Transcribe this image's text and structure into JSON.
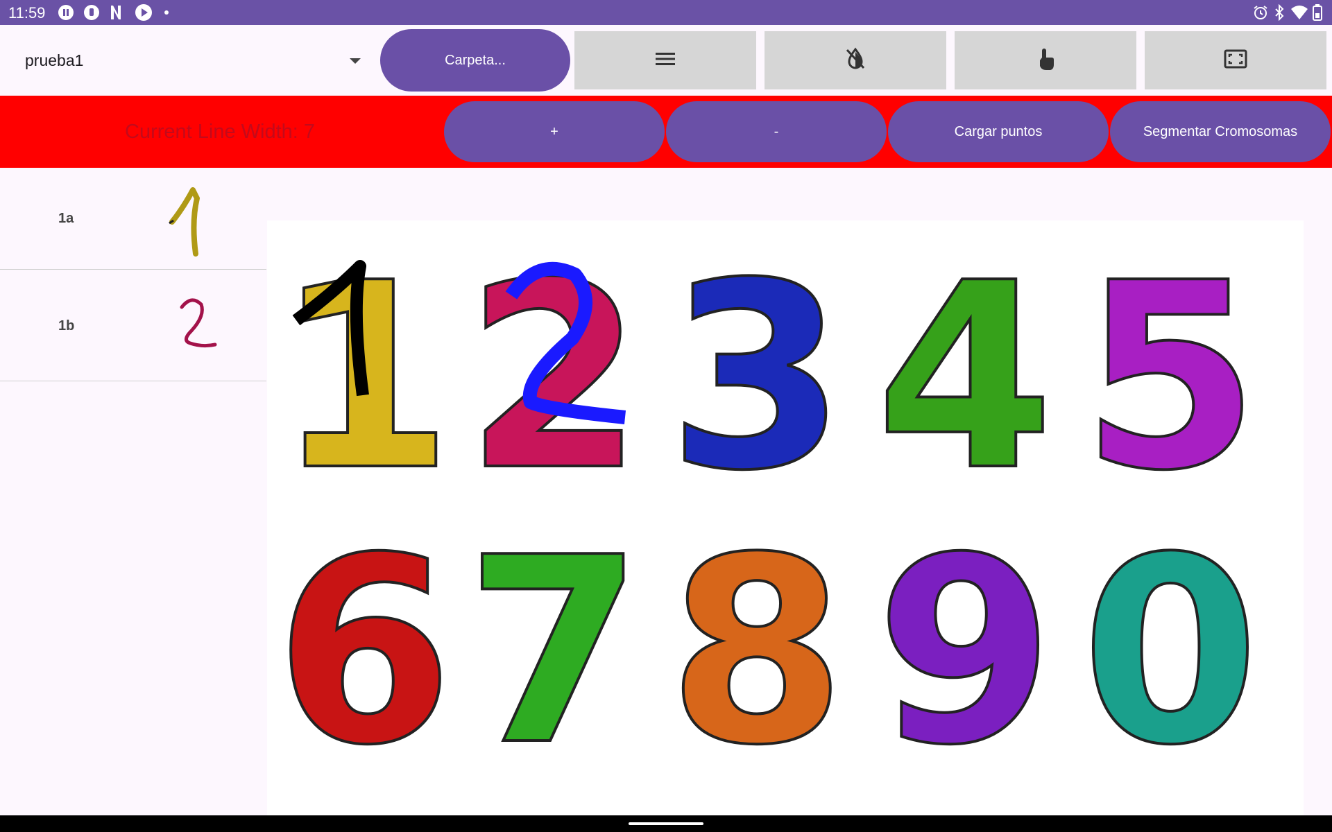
{
  "status_bar": {
    "time": "11:59",
    "left_icons": [
      "pause-circle-icon",
      "notification-icon",
      "n-logo-icon",
      "play-circle-icon",
      "dot-icon"
    ],
    "right_icons": [
      "alarm-icon",
      "bluetooth-icon",
      "wifi-icon",
      "battery-icon"
    ]
  },
  "toolbar": {
    "project_name": "prueba1",
    "folder_button": "Carpeta...",
    "tools": [
      "menu-icon",
      "invert-colors-off-icon",
      "touch-icon",
      "fullscreen-icon"
    ]
  },
  "control_bar": {
    "line_width_text": "Current Line Width: 7",
    "plus_label": "+",
    "minus_label": "-",
    "load_points_label": "Cargar puntos",
    "segment_label": "Segmentar Cromosomas",
    "background_color": "#ff0000"
  },
  "sidebar": {
    "items": [
      {
        "label": "1a",
        "glyph": "1",
        "color": "#b09a16"
      },
      {
        "label": "1b",
        "glyph": "2",
        "color": "#a3124a"
      }
    ]
  },
  "canvas": {
    "digits": [
      {
        "char": "1",
        "color": "#d7b51d"
      },
      {
        "char": "2",
        "color": "#c8155a"
      },
      {
        "char": "3",
        "color": "#1b2ab8"
      },
      {
        "char": "4",
        "color": "#36a11a"
      },
      {
        "char": "5",
        "color": "#a81fc3"
      },
      {
        "char": "6",
        "color": "#c81414"
      },
      {
        "char": "7",
        "color": "#2eab22"
      },
      {
        "char": "8",
        "color": "#d7661a"
      },
      {
        "char": "9",
        "color": "#7b1fc0"
      },
      {
        "char": "0",
        "color": "#1aa08c"
      }
    ],
    "strokes": [
      {
        "over": "1",
        "color": "#000000"
      },
      {
        "over": "2",
        "color": "#1a1aff"
      }
    ]
  },
  "colors": {
    "accent": "#6a50a7",
    "status_bar": "#6a52a6"
  }
}
